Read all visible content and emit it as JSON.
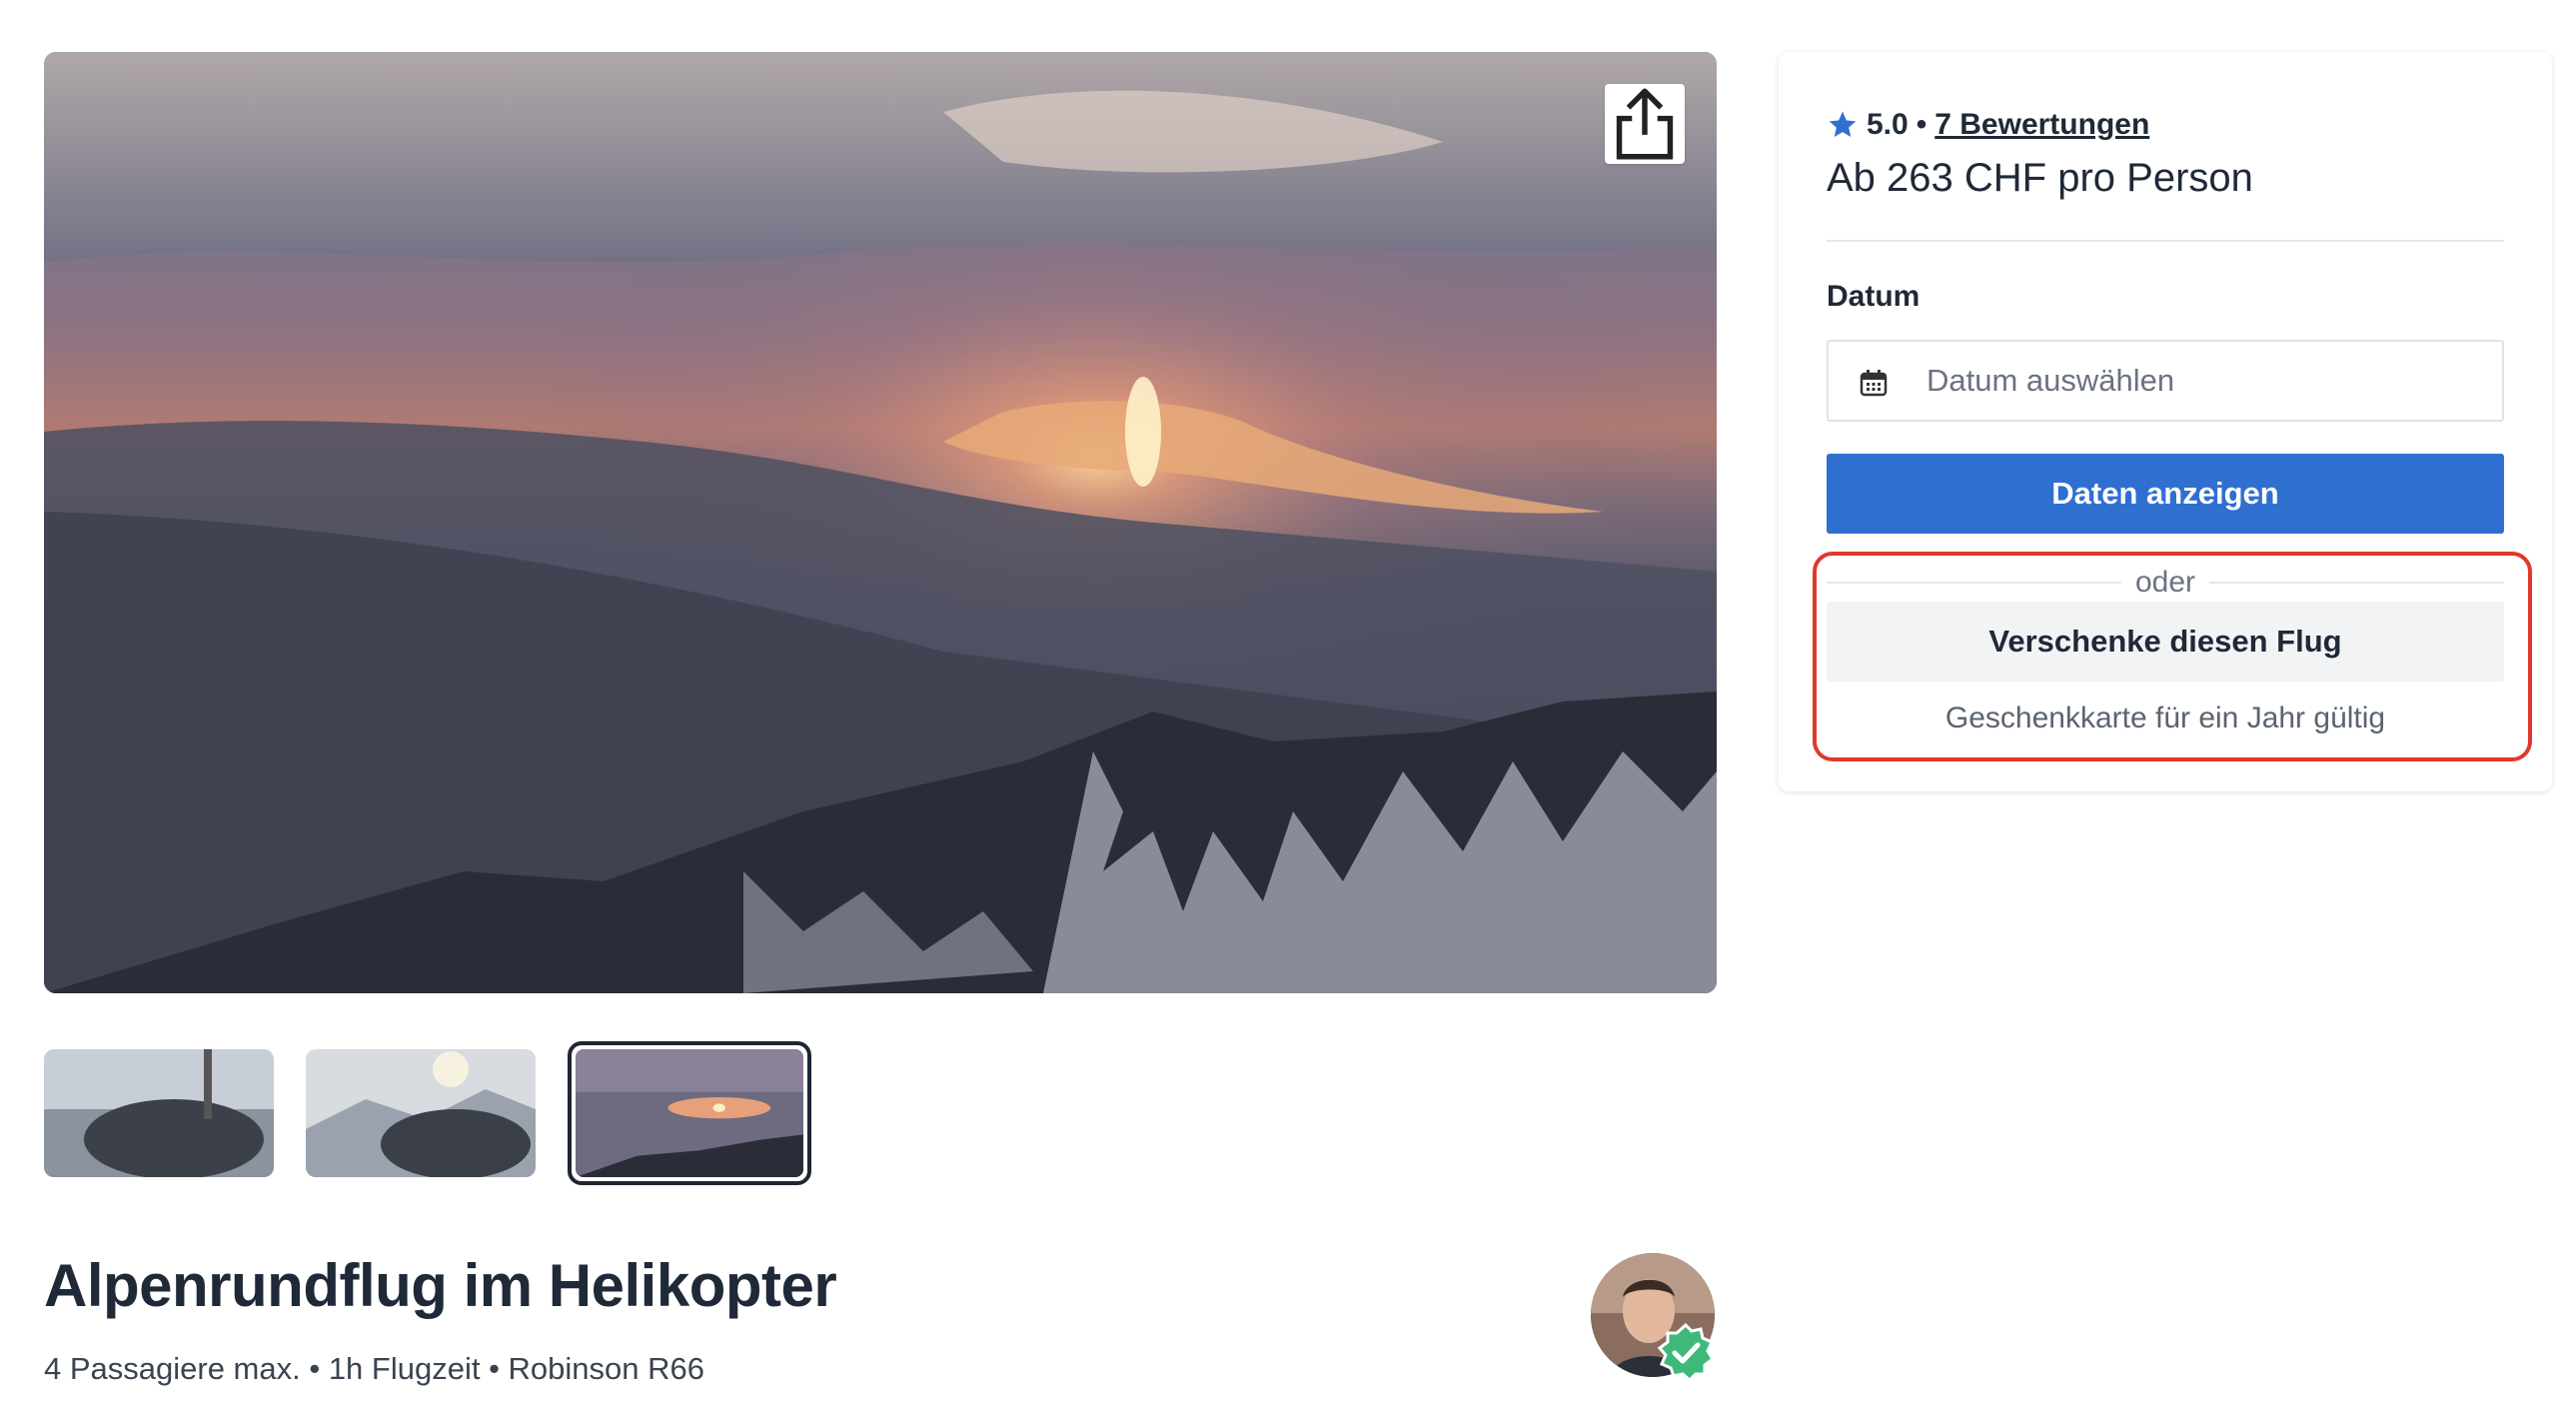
{
  "listing": {
    "title": "Alpenrundflug im Helikopter",
    "subtitle": "4 Passagiere max. • 1h Flugzeit • Robinson R66"
  },
  "gallery": {
    "thumbnail_count": 3,
    "active_thumbnail": 3,
    "share_icon": "share-icon"
  },
  "booking": {
    "rating_score": "5.0",
    "rating_separator": "•",
    "reviews_link": "7 Bewertungen",
    "price": "Ab 263 CHF pro Person",
    "date_label": "Datum",
    "date_placeholder": "Datum auswählen",
    "show_dates_button": "Daten anzeigen",
    "or_text": "oder",
    "gift_button": "Verschenke diesen Flug",
    "gift_note": "Geschenkkarte für ein Jahr gültig"
  },
  "colors": {
    "primary": "#2f6fd0",
    "star": "#2f6fd0",
    "highlight": "#e0382c",
    "verified": "#3fb97a"
  }
}
